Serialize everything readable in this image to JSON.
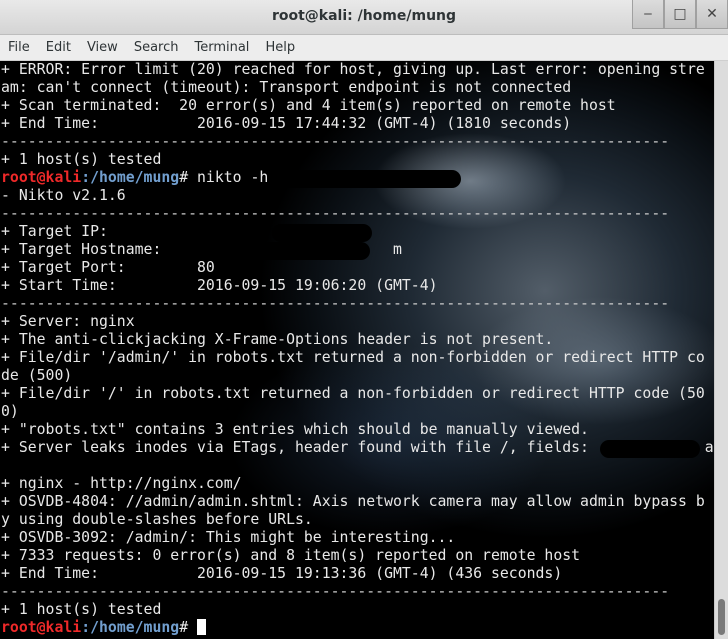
{
  "window": {
    "title": "root@kali: /home/mung",
    "buttons": {
      "minimize": "‒",
      "maximize": "□",
      "close": "✕"
    }
  },
  "menu": [
    {
      "label": "File"
    },
    {
      "label": "Edit"
    },
    {
      "label": "View"
    },
    {
      "label": "Search"
    },
    {
      "label": "Terminal"
    },
    {
      "label": "Help"
    }
  ],
  "prompt": {
    "user": "root@kali",
    "path": ":/home/mung",
    "symbol": "# "
  },
  "lines": [
    "+ ERROR: Error limit (20) reached for host, giving up. Last error: opening stre",
    "am: can't connect (timeout): Transport endpoint is not connected",
    "+ Scan terminated:  20 error(s) and 4 item(s) reported on remote host",
    "+ End Time:           2016-09-15 17:44:32 (GMT-4) (1810 seconds)",
    "---------------------------------------------------------------------------",
    "+ 1 host(s) tested",
    "__PROMPT__nikto -h",
    "- Nikto v2.1.6",
    "---------------------------------------------------------------------------",
    "+ Target IP:",
    "+ Target Hostname:                          m",
    "+ Target Port:        80",
    "+ Start Time:         2016-09-15 19:06:20 (GMT-4)",
    "---------------------------------------------------------------------------",
    "+ Server: nginx",
    "+ The anti-clickjacking X-Frame-Options header is not present.",
    "+ File/dir '/admin/' in robots.txt returned a non-forbidden or redirect HTTP co",
    "de (500)",
    "+ File/dir '/' in robots.txt returned a non-forbidden or redirect HTTP code (50",
    "0)",
    "+ \"robots.txt\" contains 3 entries which should be manually viewed.",
    "+ Server leaks inodes via ETags, header found with file /, fields:             a",
    "",
    "+ nginx - http://nginx.com/",
    "+ OSVDB-4804: //admin/admin.shtml: Axis network camera may allow admin bypass b",
    "y using double-slashes before URLs.",
    "+ OSVDB-3092: /admin/: This might be interesting...",
    "+ 7333 requests: 0 error(s) and 8 item(s) reported on remote host",
    "+ End Time:           2016-09-15 19:13:36 (GMT-4) (436 seconds)",
    "---------------------------------------------------------------------------",
    "+ 1 host(s) tested",
    "__PROMPT__"
  ]
}
